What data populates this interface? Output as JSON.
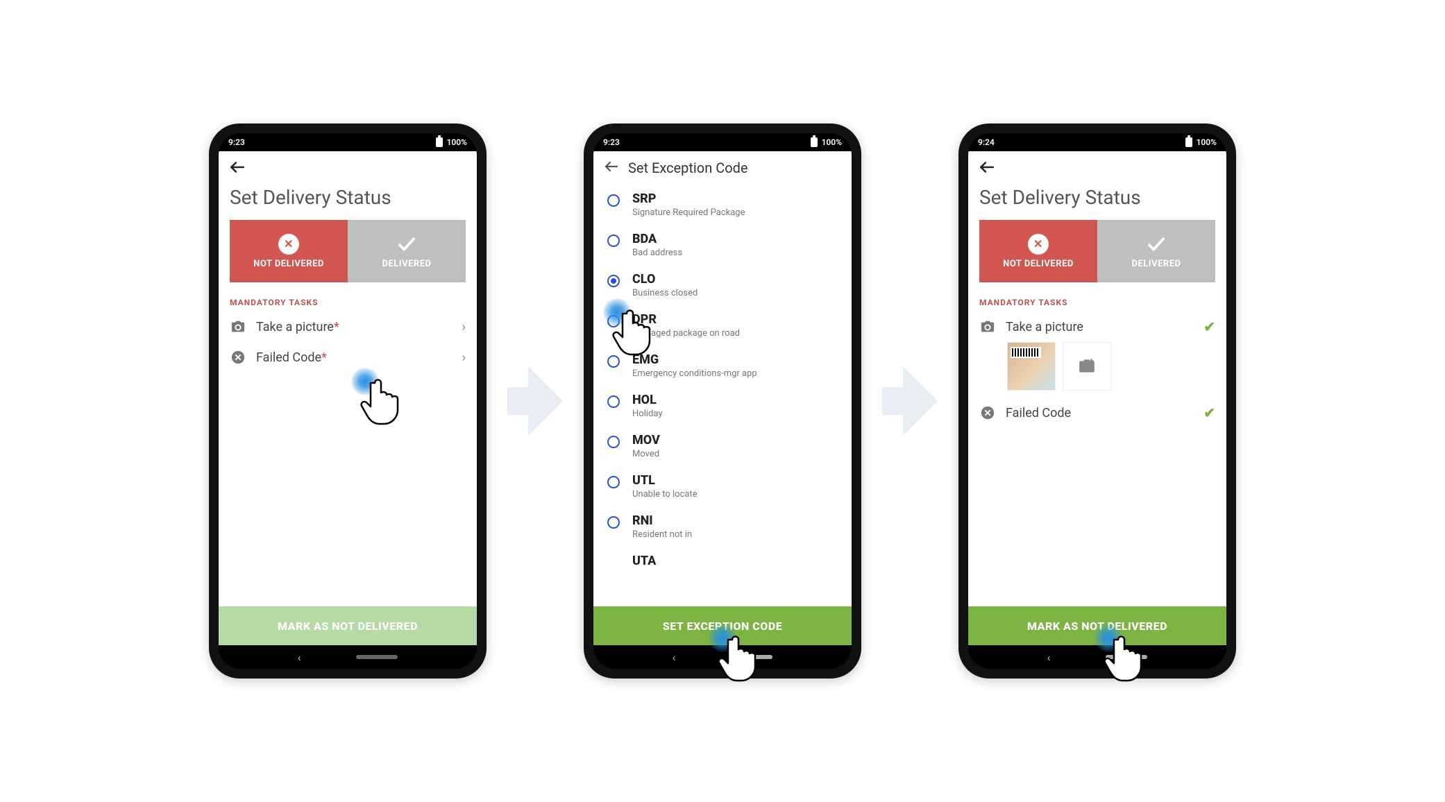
{
  "phones": [
    {
      "status_time": "9:23",
      "status_battery": "100%",
      "title": "Set Delivery Status",
      "tabs": {
        "not_delivered": "NOT DELIVERED",
        "delivered": "DELIVERED"
      },
      "mandatory_label": "MANDATORY TASKS",
      "tasks": {
        "picture": {
          "label": "Take a picture",
          "required": "*"
        },
        "failed": {
          "label": "Failed Code",
          "required": "*"
        }
      },
      "action": "MARK AS NOT DELIVERED"
    },
    {
      "status_time": "9:23",
      "status_battery": "100%",
      "header": "Set Exception Code",
      "options": [
        {
          "code": "SRP",
          "desc": "Signature Required Package"
        },
        {
          "code": "BDA",
          "desc": "Bad address"
        },
        {
          "code": "CLO",
          "desc": "Business closed"
        },
        {
          "code": "DPR",
          "desc": "Damaged package on road"
        },
        {
          "code": "EMG",
          "desc": "Emergency conditions-mgr app"
        },
        {
          "code": "HOL",
          "desc": "Holiday"
        },
        {
          "code": "MOV",
          "desc": "Moved"
        },
        {
          "code": "UTL",
          "desc": "Unable to locate"
        },
        {
          "code": "RNI",
          "desc": "Resident not in"
        },
        {
          "code": "UTA",
          "desc": ""
        }
      ],
      "selected_index": 2,
      "action": "SET EXCEPTION CODE"
    },
    {
      "status_time": "9:24",
      "status_battery": "100%",
      "title": "Set Delivery Status",
      "tabs": {
        "not_delivered": "NOT DELIVERED",
        "delivered": "DELIVERED"
      },
      "mandatory_label": "MANDATORY TASKS",
      "tasks": {
        "picture": {
          "label": "Take a picture"
        },
        "failed": {
          "label": "Failed Code"
        }
      },
      "action": "MARK AS NOT DELIVERED"
    }
  ]
}
